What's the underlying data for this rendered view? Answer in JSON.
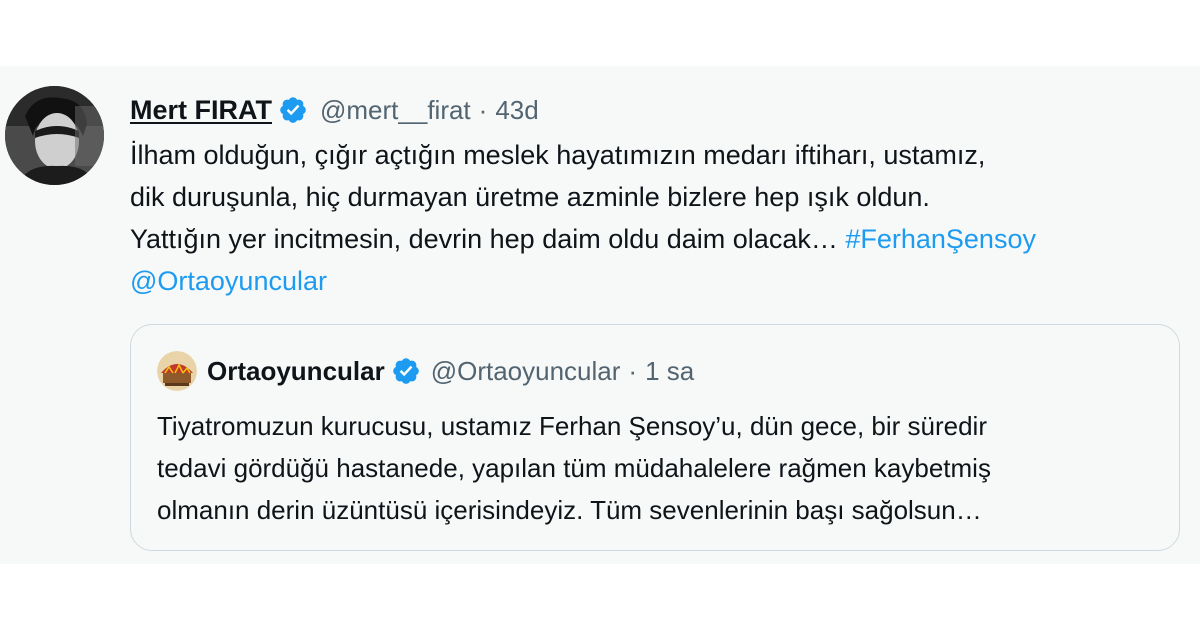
{
  "tweet": {
    "author_name": "Mert FIRAT",
    "handle": "@mert__firat",
    "separator": "·",
    "time": "43d",
    "text_lines": [
      "İlham olduğun, çığır açtığın meslek hayatımızın medarı iftiharı, ustamız,",
      "dik duruşunla, hiç durmayan üretme azminle bizlere hep ışık oldun.",
      "Yattığın yer incitmesin, devrin hep daim oldu daim olacak… "
    ],
    "hashtag": "#FerhanŞensoy",
    "mention": "@Ortaoyuncular",
    "verified_icon": "verified-badge-icon"
  },
  "quoted_tweet": {
    "author_name": "Ortaoyuncular",
    "handle": "@Ortaoyuncular",
    "separator": "·",
    "time": "1 sa",
    "text_lines": [
      "Tiyatromuzun kurucusu, ustamız Ferhan Şensoy’u, dün gece, bir süredir",
      "tedavi gördüğü hastanede, yapılan tüm müdahalelere rağmen kaybetmiş",
      "olmanın derin üzüntüsü içerisindeyiz. Tüm sevenlerinin başı sağolsun…"
    ]
  },
  "colors": {
    "link": "#1d9bf0",
    "verified": "#1d9bf0",
    "text_primary": "#0f1419",
    "text_secondary": "#536471",
    "card_background": "#f7f9f9"
  }
}
